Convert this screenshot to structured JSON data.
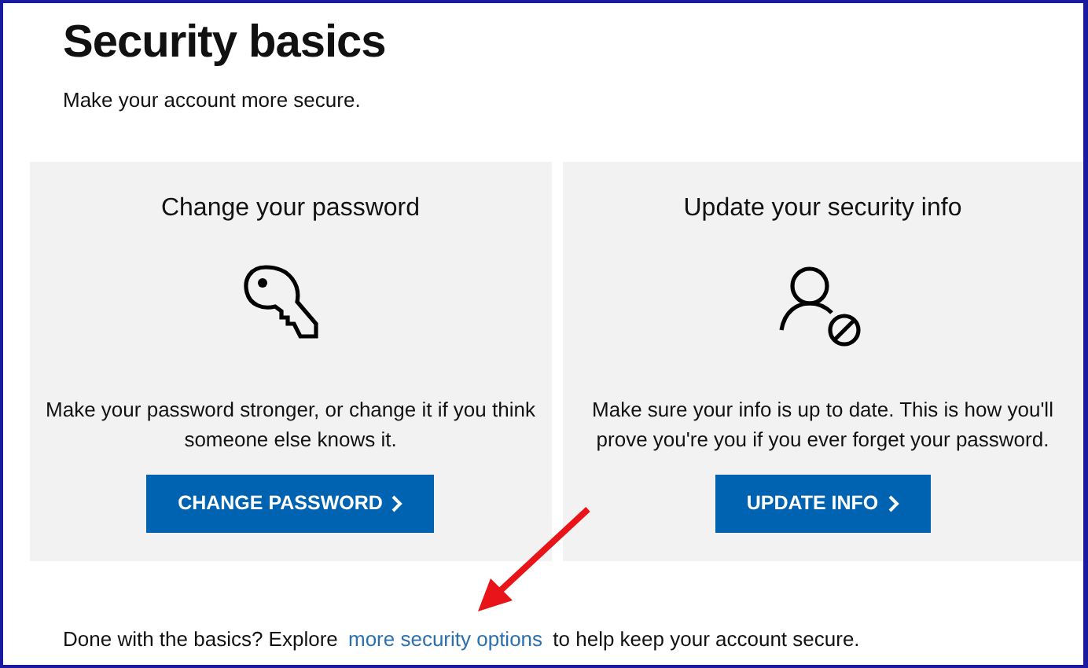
{
  "title": "Security basics",
  "subtitle": "Make your account more secure.",
  "cards": [
    {
      "kind": "key",
      "title": "Change your password",
      "description": "Make your password stronger, or change it if you think someone else knows it.",
      "button": "CHANGE PASSWORD"
    },
    {
      "kind": "person",
      "title": "Update your security info",
      "description": "Make sure your info is up to date. This is how you'll prove you're you if you ever forget your password.",
      "button": "UPDATE INFO"
    }
  ],
  "footer": {
    "before": "Done with the basics? Explore",
    "link": "more security options",
    "after": "to help keep your account secure."
  }
}
